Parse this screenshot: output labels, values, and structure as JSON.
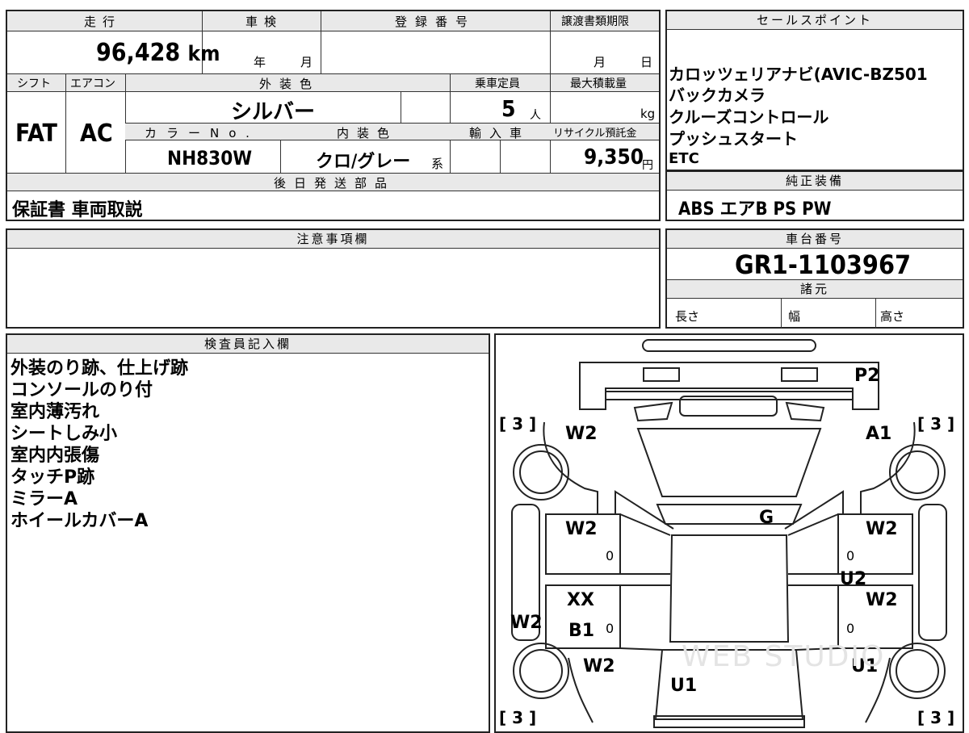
{
  "top_table": {
    "h_mileage": "走行",
    "h_shaken": "車検",
    "h_reg": "登録番号",
    "h_transfer": "譲渡書類期限",
    "mileage_value": "96,428",
    "mileage_unit": "km",
    "shaken_year": "年",
    "shaken_month": "月",
    "transfer_month": "月",
    "transfer_day": "日",
    "h_shift": "シフト",
    "h_ac": "エアコン",
    "h_ext_color": "外装色",
    "h_capacity": "乗車定員",
    "h_max_load": "最大積載量",
    "shift": "FAT",
    "ac": "AC",
    "ext_color": "シルバー",
    "capacity": "5",
    "capacity_unit": "人",
    "load_unit": "kg",
    "h_color_no": "カラーNo.",
    "h_int_color": "内装色",
    "h_import": "輸入車",
    "h_recycle": "リサイクル預託金",
    "color_no": "NH830W",
    "int_color": "クロ/グレー",
    "int_suffix": "系",
    "recycle": "9,350",
    "recycle_unit": "円",
    "h_later": "後日発送部品",
    "later": "保証書 車両取説"
  },
  "sales": {
    "header": "セールスポイント",
    "items": [
      "カロッツェリアナビ(AVIC-BZ501",
      "バックカメラ",
      "クルーズコントロール",
      "プッシュスタート",
      "ETC"
    ]
  },
  "equipment": {
    "header": "純正装備",
    "value": "ABS エアB PS PW"
  },
  "caution": {
    "header": "注意事項欄"
  },
  "chassis": {
    "header": "車台番号",
    "value": "GR1-1103967"
  },
  "specs": {
    "header": "諸元",
    "length": "長さ",
    "width": "幅",
    "height": "高さ"
  },
  "inspector": {
    "header": "検査員記入欄",
    "lines": [
      "外装のり跡、仕上げ跡",
      "コンソールのり付",
      "室内薄汚れ",
      "シートしみ小",
      "室内内張傷",
      "タッチP跡",
      "ミラーA",
      "ホイールカバーA"
    ]
  },
  "diagram": {
    "labels": {
      "p2": "P2",
      "w2_fl": "W2",
      "a1": "A1",
      "g": "G",
      "w2_fd": "W2",
      "w2_rd": "W2",
      "xx": "XX",
      "u2": "U2",
      "w2_fr": "W2",
      "w2_side": "W2",
      "b1": "B1",
      "w2_rear": "W2",
      "u1_r": "U1",
      "u1_c": "U1"
    },
    "tire_marks": [
      "[ 3 ]",
      "[ 3 ]",
      "[ 3 ]",
      "[ 3 ]"
    ],
    "zero": "0",
    "watermark": "WEB STUDIO"
  }
}
